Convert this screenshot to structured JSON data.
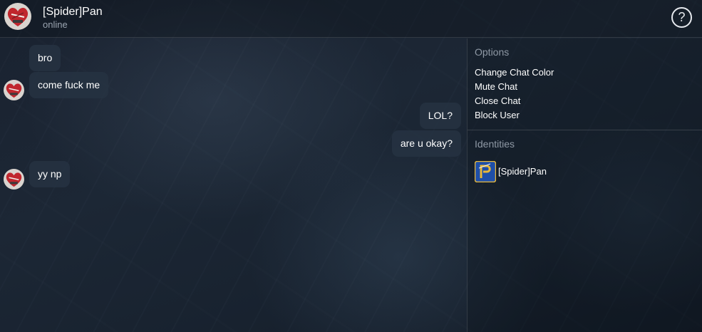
{
  "header": {
    "title": "[Spider]Pan",
    "status": "online",
    "help_label": "?"
  },
  "messages": [
    {
      "text": "bro",
      "side": "left"
    },
    {
      "text": "come fuck me",
      "side": "left"
    },
    {
      "text": "LOL?",
      "side": "right"
    },
    {
      "text": "are u okay?",
      "side": "right"
    },
    {
      "text": "yy np",
      "side": "left"
    }
  ],
  "panel": {
    "options_title": "Options",
    "options": [
      "Change Chat Color",
      "Mute Chat",
      "Close Chat",
      "Block User"
    ],
    "identities_title": "Identities",
    "identity_name": "[Spider]Pan"
  },
  "icons": {
    "avatar": "heart-avatar-icon",
    "identity": "p-logo-icon",
    "help": "help-icon"
  },
  "colors": {
    "bubble": "#263242",
    "section_title": "#8f99a5",
    "status": "#9aa4b0",
    "identity_icon_bg": "#1f4fa8",
    "identity_icon_accent": "#e8b83a"
  }
}
